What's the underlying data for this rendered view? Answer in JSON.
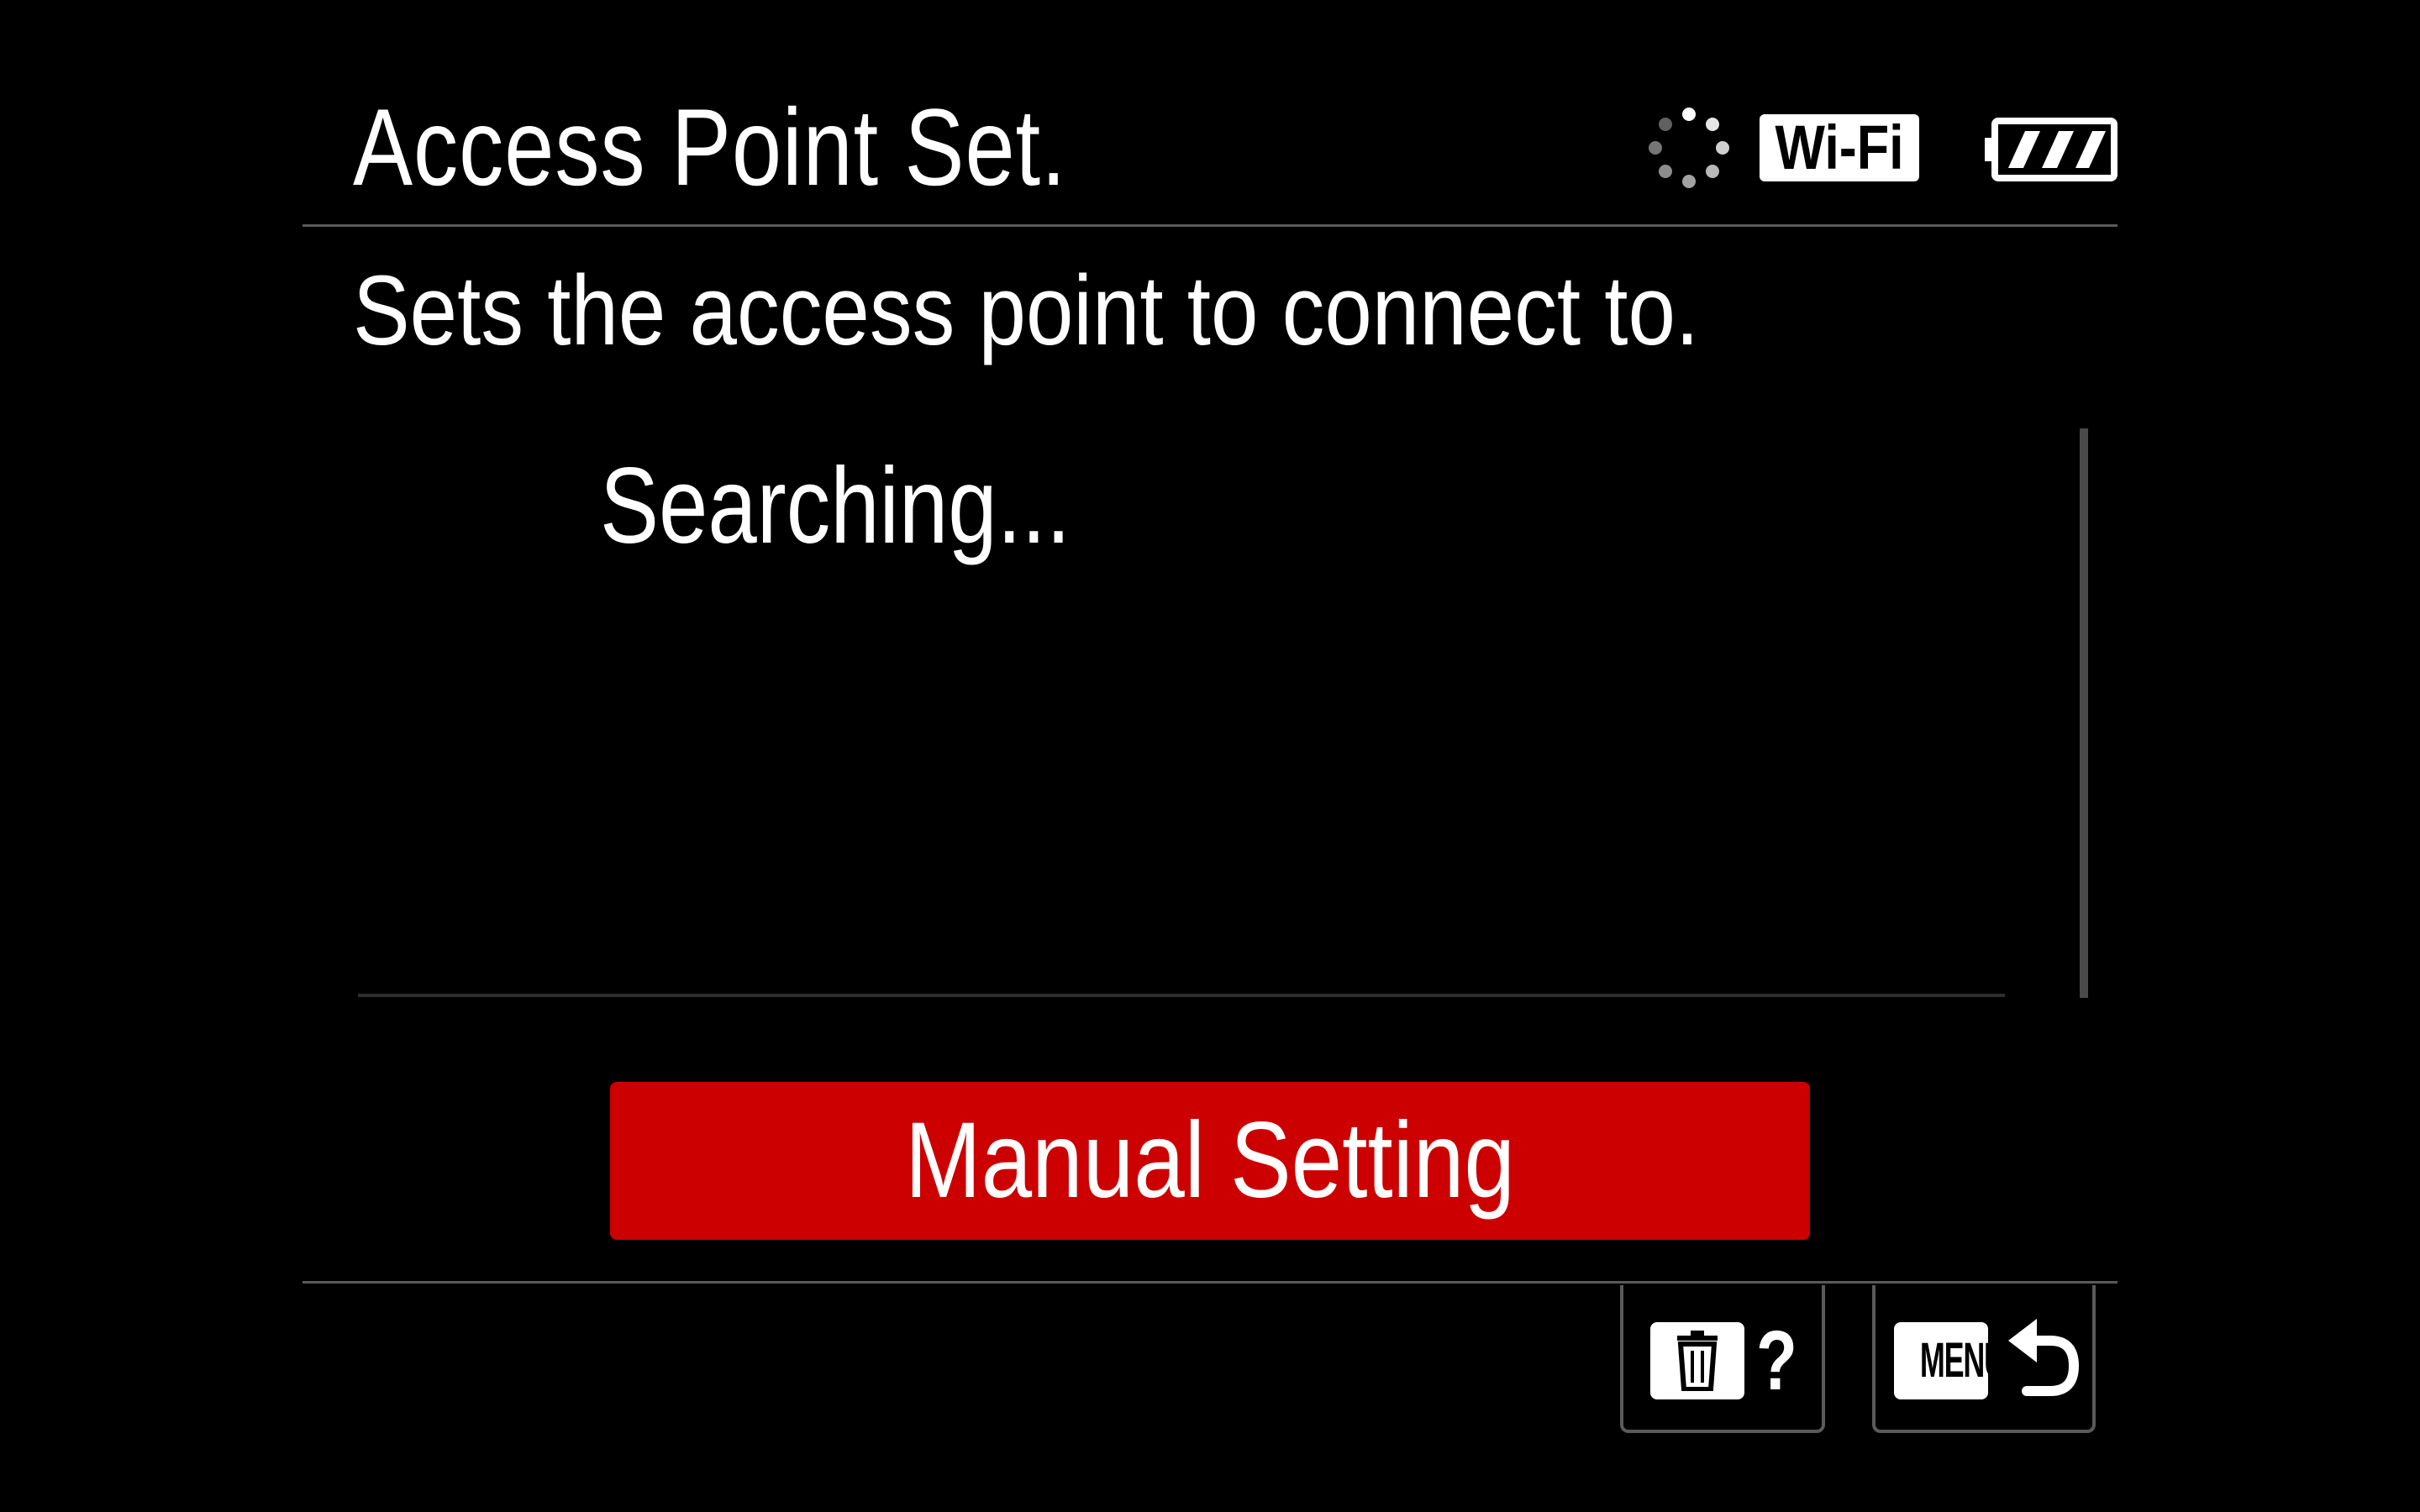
{
  "header": {
    "title": "Access Point Set.",
    "status": {
      "spinner_icon": "loading-spinner-icon",
      "wifi_label": "Wi-Fi",
      "battery_icon": "battery-full-icon"
    }
  },
  "description": "Sets the access point to connect to.",
  "access_point_list": {
    "status_text": "Searching..."
  },
  "manual_setting_button": {
    "label": "Manual Setting",
    "color": "#cc0000"
  },
  "footer": {
    "help_hint": {
      "icon": "trash-icon",
      "label": "?"
    },
    "back_hint": {
      "key_label": "MENU",
      "icon": "back-arrow-icon"
    }
  }
}
